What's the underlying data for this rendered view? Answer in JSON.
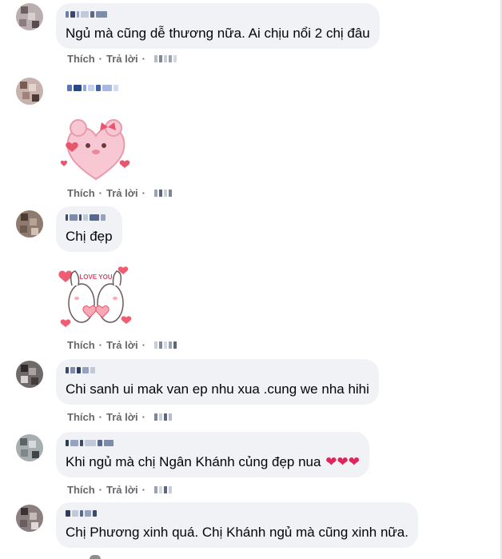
{
  "comments": [
    {
      "text": "Ngủ mà cũng dễ thương nữa. Ai chịu nổi 2 chị đâu",
      "like_label": "Thích",
      "reply_label": "Trả lời"
    },
    {
      "text": "",
      "sticker": "heart-bear-sticker",
      "like_label": "Thích",
      "reply_label": "Trả lời"
    },
    {
      "text": "Chị đẹp",
      "sticker": "love-you-bunnies-sticker",
      "sticker_text": "LOVE YOU",
      "like_label": "Thích",
      "reply_label": "Trả lời"
    },
    {
      "text": "Chi sanh ui mak van ep nhu xua .cung we nha hihi",
      "like_label": "Thích",
      "reply_label": "Trả lời"
    },
    {
      "text": "Khi ngủ mà chị Ngân Khánh củng đẹp nua",
      "emoji": "❤❤❤",
      "like_label": "Thích",
      "reply_label": "Trả lời"
    },
    {
      "text": "Chị Phương xinh quá. Chị Khánh ngủ mà cũng xinh nữa.",
      "like_label": "Thích",
      "reply_label": "Trả lời"
    }
  ],
  "colors": {
    "bubble": "#f0f2f5",
    "action_text": "#65676b",
    "heart": "#e0245e"
  }
}
